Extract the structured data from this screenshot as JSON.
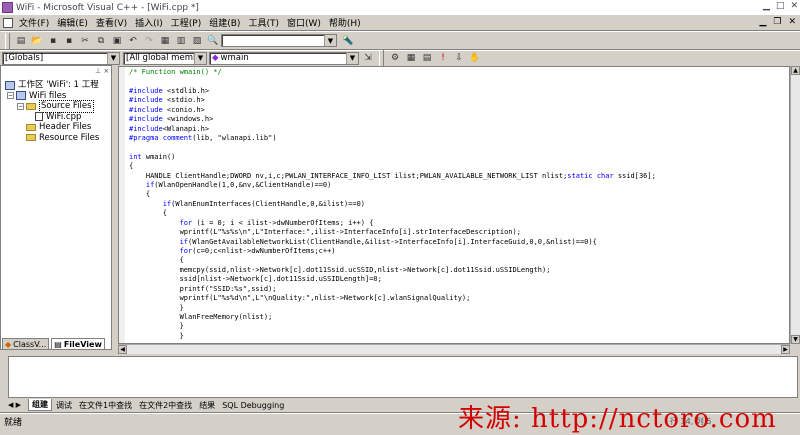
{
  "window": {
    "title": "WiFi - Microsoft Visual C++ - [WiFi.cpp *]"
  },
  "menu": [
    "文件(F)",
    "编辑(E)",
    "查看(V)",
    "插入(I)",
    "工程(P)",
    "组建(B)",
    "工具(T)",
    "窗口(W)",
    "帮助(H)"
  ],
  "toolbar": {
    "find_value": ""
  },
  "wizardbar": {
    "class_combo": "[Globals]",
    "members_combo": "[All global members",
    "function_combo": "wmain"
  },
  "workspace": {
    "root": "工作区 'WiFi': 1 工程",
    "project": "WiFi files",
    "source_folder": "Source Files",
    "source_file": "WiFi.cpp",
    "header_folder": "Header Files",
    "resource_folder": "Resource Files",
    "tabs": [
      "ClassV...",
      "FileView"
    ]
  },
  "code_lines": [
    "/* Function wmain() */",
    "",
    "#include <stdlib.h>",
    "#include <stdio.h>",
    "#include <conio.h>",
    "#include <windows.h>",
    "#include<Wlanapi.h>",
    "#pragma comment(lib, \"wlanapi.lib\")",
    "",
    "int wmain()",
    "{",
    "    HANDLE ClientHandle;DWORD nv,i,c;PWLAN_INTERFACE_INFO_LIST ilist;PWLAN_AVAILABLE_NETWORK_LIST nlist;static char ssid[36];",
    "    if(WlanOpenHandle(1,0,&nv,&ClientHandle)==0)",
    "    {",
    "        if(WlanEnumInterfaces(ClientHandle,0,&ilist)==0)",
    "        {",
    "            for (i = 0; i < ilist->dwNumberOfItems; i++) {",
    "            wprintf(L\"%s%s\\n\",L\"Interface:\",ilist->InterfaceInfo[i].strInterfaceDescription);",
    "            if(WlanGetAvailableNetworkList(ClientHandle,&ilist->InterfaceInfo[i].InterfaceGuid,0,0,&nlist)==0){",
    "            for(c=0;c<nlist->dwNumberOfItems;c++)",
    "            {",
    "            memcpy(ssid,nlist->Network[c].dot11Ssid.ucSSID,nlist->Network[c].dot11Ssid.uSSIDLength);",
    "            ssid[nlist->Network[c].dot11Ssid.uSSIDLength]=0;",
    "            printf(\"SSID:%s\",ssid);",
    "            wprintf(L\"%s%d\\n\",L\"\\nQuality:\",nlist->Network[c].wlanSignalQuality);",
    "            }",
    "            WlanFreeMemory(nlist);",
    "            }",
    "            }"
  ],
  "output_tabs": [
    "组建",
    "调试",
    "在文件1中查找",
    "在文件2中查找",
    "结果",
    "SQL Debugging"
  ],
  "status": {
    "left": "就绪",
    "position": "行 14, 列 5"
  },
  "watermark": "来源: http://nctoro.com",
  "colors": {
    "keyword": "#0000ff",
    "comment": "#008000",
    "watermark": "#d40000"
  }
}
